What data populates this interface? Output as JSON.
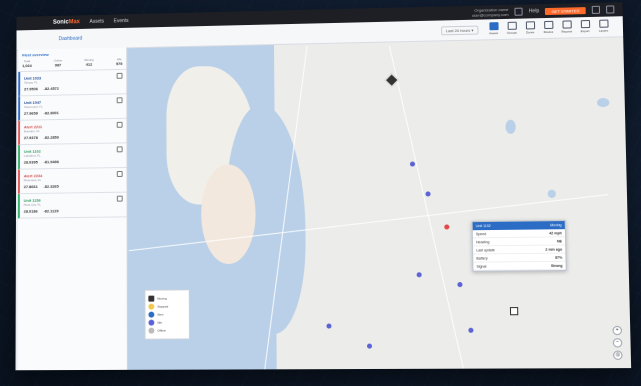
{
  "app": {
    "logo_left": "Sonic",
    "logo_right": "Max",
    "tabs": [
      "Assets",
      "Events"
    ]
  },
  "account": {
    "line1": "Organization name",
    "line2": "user@company.com",
    "menu": "Help",
    "cta": "GET STARTED"
  },
  "subbar": {
    "title": "Dashboard",
    "filter": "Last 24 hours  ▾",
    "tools": [
      "Assets",
      "Groups",
      "Zones",
      "Routes",
      "Reports",
      "Export",
      "Layers"
    ]
  },
  "summary": {
    "header": "Fleet overview",
    "stats": [
      {
        "k": "Total",
        "v": "1,024"
      },
      {
        "k": "Online",
        "v": "987"
      },
      {
        "k": "Moving",
        "v": "412"
      },
      {
        "k": "Idle",
        "v": "575"
      }
    ]
  },
  "cards": [
    {
      "id": "Unit 1023",
      "sub": "Tampa, FL",
      "lat": "27.9506",
      "lng": "-82.4572",
      "color": "blue"
    },
    {
      "id": "Unit 1047",
      "sub": "Clearwater, FL",
      "lat": "27.9659",
      "lng": "-82.8001",
      "color": "blue"
    },
    {
      "id": "Alert 2211",
      "sub": "Brandon, FL",
      "lat": "27.9378",
      "lng": "-82.2859",
      "color": "red"
    },
    {
      "id": "Unit 1102",
      "sub": "Lakeland, FL",
      "lat": "28.0395",
      "lng": "-81.9498",
      "color": "green"
    },
    {
      "id": "Alert 2234",
      "sub": "Riverview, FL",
      "lat": "27.8661",
      "lng": "-82.3265",
      "color": "red"
    },
    {
      "id": "Unit 1156",
      "sub": "Plant City, FL",
      "lat": "28.0186",
      "lng": "-82.1129",
      "color": "green"
    }
  ],
  "popup": {
    "title": "Unit 1102",
    "status": "Moving",
    "rows": [
      [
        "Speed",
        "42 mph"
      ],
      [
        "Heading",
        "NE"
      ],
      [
        "Last update",
        "2 min ago"
      ],
      [
        "Battery",
        "87%"
      ],
      [
        "Signal",
        "Strong"
      ]
    ]
  },
  "legend": {
    "items": [
      "Moving",
      "Stopped",
      "Alert",
      "Idle",
      "Offline"
    ]
  },
  "colors": {
    "accent": "#2b6cc4",
    "brand": "#ff6a2b",
    "alert": "#e24848",
    "ok": "#3ab26f",
    "marker": "#5c63d6"
  }
}
